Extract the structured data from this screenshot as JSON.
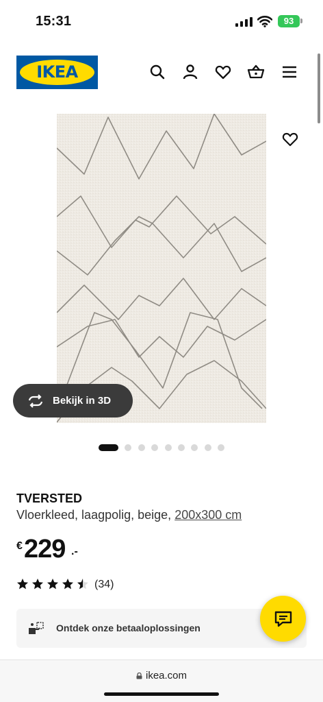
{
  "status_bar": {
    "time": "15:31",
    "battery": "93"
  },
  "header": {
    "logo_text": "IKEA",
    "icons": [
      "search-icon",
      "user-icon",
      "heart-icon",
      "basket-icon",
      "menu-icon"
    ]
  },
  "gallery": {
    "view_3d_label": "Bekijk in 3D",
    "slide_count": 9,
    "active_slide": 1
  },
  "product": {
    "name": "TVERSTED",
    "description": "Vloerkleed, laagpolig, beige,",
    "size": "200x300 cm",
    "price_currency": "€",
    "price_integer": "229",
    "price_decimals": ".-",
    "rating_stars": 4.5,
    "rating_count": "(34)"
  },
  "payment_banner": {
    "label": "Ontdek onze betaaloplossingen"
  },
  "browser": {
    "url": "ikea.com"
  },
  "colors": {
    "ikea_blue": "#0058a3",
    "ikea_yellow": "#ffdb00",
    "battery_green": "#34c759"
  }
}
